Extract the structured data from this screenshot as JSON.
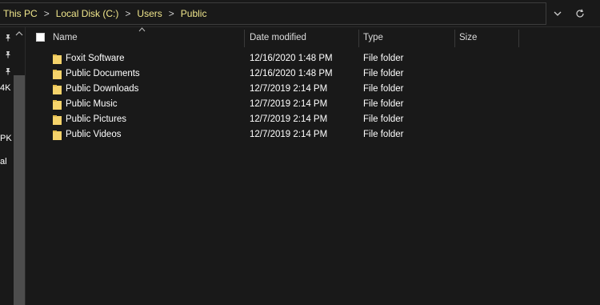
{
  "address": {
    "crumbs": [
      "This PC",
      "Local Disk (C:)",
      "Users",
      "Public"
    ],
    "separator": ">"
  },
  "icons": {
    "dropdown": "chevron-down-icon",
    "refresh": "refresh-icon",
    "folder": "folder-icon",
    "pin": "pin-icon"
  },
  "colors": {
    "background": "#191919",
    "breadcrumb_text": "#f0e68c",
    "folder": "#f5d36b"
  },
  "sidebar": {
    "labels": [
      "4K",
      "PK",
      "al"
    ]
  },
  "columns": {
    "name": "Name",
    "date": "Date modified",
    "type": "Type",
    "size": "Size"
  },
  "files": [
    {
      "name": "Foxit Software",
      "date": "12/16/2020 1:48 PM",
      "type": "File folder",
      "size": ""
    },
    {
      "name": "Public Documents",
      "date": "12/16/2020 1:48 PM",
      "type": "File folder",
      "size": ""
    },
    {
      "name": "Public Downloads",
      "date": "12/7/2019 2:14 PM",
      "type": "File folder",
      "size": ""
    },
    {
      "name": "Public Music",
      "date": "12/7/2019 2:14 PM",
      "type": "File folder",
      "size": ""
    },
    {
      "name": "Public Pictures",
      "date": "12/7/2019 2:14 PM",
      "type": "File folder",
      "size": ""
    },
    {
      "name": "Public Videos",
      "date": "12/7/2019 2:14 PM",
      "type": "File folder",
      "size": ""
    }
  ]
}
